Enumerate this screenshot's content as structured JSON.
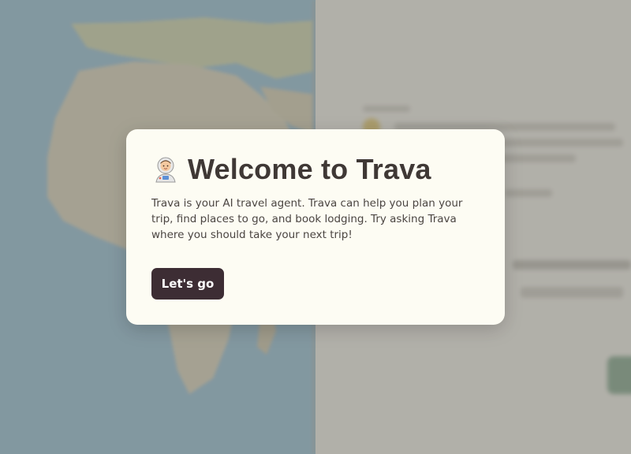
{
  "modal": {
    "icon": "astronaut-icon",
    "title": "Welcome to Trava",
    "body": "Trava is your AI travel agent. Trava can help you plan your trip, find places to go, and book lodging. Try asking Trava where you should take your next trip!",
    "cta_label": "Let's go"
  },
  "colors": {
    "modal_bg": "#fdfcf3",
    "button_bg": "#3d2d34",
    "title_text": "#3f3835",
    "overlay": "rgba(120,118,112,0.55)"
  }
}
